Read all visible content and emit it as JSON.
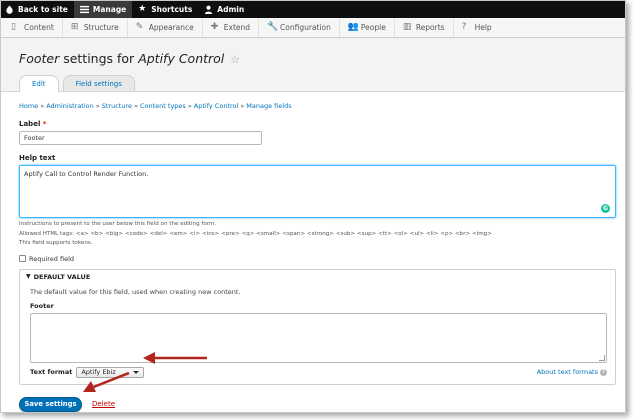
{
  "toolbar": {
    "back": "Back to site",
    "manage": "Manage",
    "shortcuts": "Shortcuts",
    "admin": "Admin"
  },
  "tray": {
    "items": [
      "Content",
      "Structure",
      "Appearance",
      "Extend",
      "Configuration",
      "People",
      "Reports",
      "Help"
    ]
  },
  "header": {
    "title_prefix": "Footer",
    "title_middle": " settings for ",
    "title_entity": "Aptify Control"
  },
  "tabs": {
    "edit": "Edit",
    "field_settings": "Field settings"
  },
  "breadcrumb": [
    "Home",
    "Administration",
    "Structure",
    "Content types",
    "Aptify Control",
    "Manage fields"
  ],
  "breadcrumb_sep": "»",
  "form": {
    "label_title": "Label",
    "label_value": "Footer",
    "help_title": "Help text",
    "help_value": "Aptify Call to Control Render Function.",
    "desc_1": "Instructions to present to the user below this field on the editing form.",
    "desc_2": "Allowed HTML tags: <a> <b> <big> <code> <del> <em> <i> <ins> <pre> <q> <small> <span> <strong> <sub> <sup> <tt> <ol> <ul> <li> <p> <br> <img>",
    "desc_3": "This field supports tokens.",
    "required_label": "Required field"
  },
  "default_value": {
    "summary": "DEFAULT VALUE",
    "description": "The default value for this field, used when creating new content.",
    "footer_label": "Footer",
    "text_format_label": "Text format",
    "text_format_value": "Aptify Ebiz",
    "about_link": "About text formats"
  },
  "actions": {
    "save": "Save settings",
    "delete": "Delete"
  },
  "colors": {
    "link": "#0074bd",
    "primary_button": "#0071b8",
    "arrow": "#b3261e",
    "toolbar": "#0f0f0f"
  }
}
